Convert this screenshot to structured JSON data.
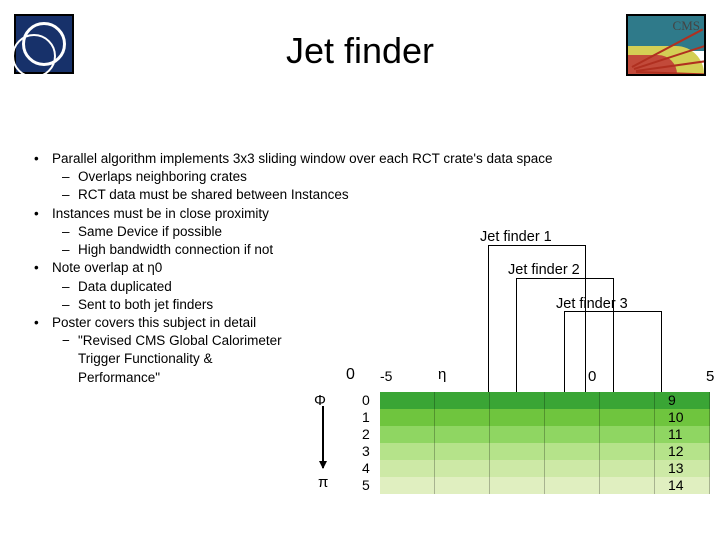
{
  "header": {
    "title": "Jet finder",
    "cms_label": "CMS"
  },
  "bullets": {
    "b1": "Parallel algorithm implements 3x3 sliding window over each RCT crate's data space",
    "b1s1": "Overlaps neighboring crates",
    "b1s2": "RCT data must be shared between Instances",
    "b2": "Instances must be in close proximity",
    "b2s1": "Same Device if possible",
    "b2s2": "High bandwidth connection if not",
    "b3": "Note overlap at η0",
    "b3s1": "Data duplicated",
    "b3s2": "Sent to both jet finders",
    "b4": "Poster covers this subject in detail",
    "b4s1": "\"Revised CMS Global Calorimeter Trigger Functionality & Performance\""
  },
  "callouts": {
    "jf1": "Jet finder 1",
    "jf2": "Jet finder 2",
    "jf3": "Jet finder 3"
  },
  "diagram": {
    "eta": "η",
    "phi": "Φ",
    "pi": "π",
    "neg5": "-5",
    "zero_left": "0",
    "zero_mid": "0",
    "five": "5",
    "left_rows": [
      "0",
      "1",
      "2",
      "3",
      "4",
      "5"
    ],
    "right_rows": [
      "9",
      "10",
      "11",
      "12",
      "13",
      "14"
    ],
    "row_colors": [
      "#3aa535",
      "#6fc53e",
      "#8fd662",
      "#b5e38a",
      "#cde9a6",
      "#e0efc0"
    ]
  }
}
